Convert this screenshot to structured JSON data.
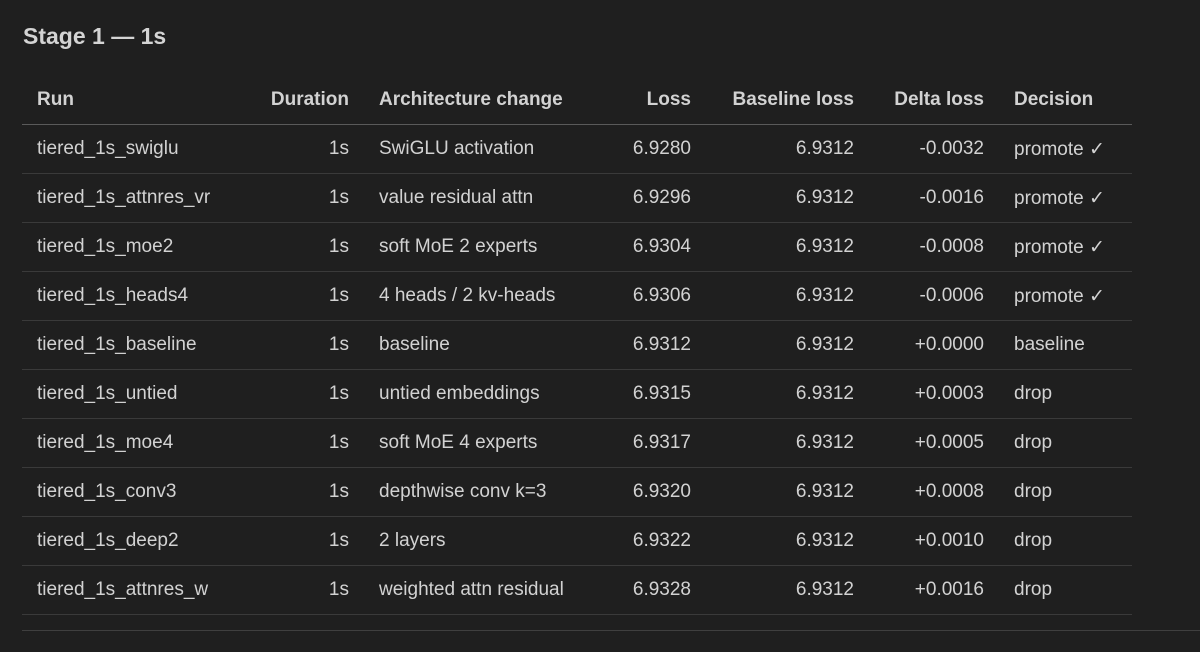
{
  "title": "Stage 1 — 1s",
  "columns": [
    "Run",
    "Duration",
    "Architecture change",
    "Loss",
    "Baseline loss",
    "Delta loss",
    "Decision"
  ],
  "rows": [
    [
      "tiered_1s_swiglu",
      "1s",
      "SwiGLU activation",
      "6.9280",
      "6.9312",
      "-0.0032",
      "promote ✓"
    ],
    [
      "tiered_1s_attnres_vr",
      "1s",
      "value residual attn",
      "6.9296",
      "6.9312",
      "-0.0016",
      "promote ✓"
    ],
    [
      "tiered_1s_moe2",
      "1s",
      "soft MoE 2 experts",
      "6.9304",
      "6.9312",
      "-0.0008",
      "promote ✓"
    ],
    [
      "tiered_1s_heads4",
      "1s",
      "4 heads / 2 kv-heads",
      "6.9306",
      "6.9312",
      "-0.0006",
      "promote ✓"
    ],
    [
      "tiered_1s_baseline",
      "1s",
      "baseline",
      "6.9312",
      "6.9312",
      "+0.0000",
      "baseline"
    ],
    [
      "tiered_1s_untied",
      "1s",
      "untied embeddings",
      "6.9315",
      "6.9312",
      "+0.0003",
      "drop"
    ],
    [
      "tiered_1s_moe4",
      "1s",
      "soft MoE 4 experts",
      "6.9317",
      "6.9312",
      "+0.0005",
      "drop"
    ],
    [
      "tiered_1s_conv3",
      "1s",
      "depthwise conv k=3",
      "6.9320",
      "6.9312",
      "+0.0008",
      "drop"
    ],
    [
      "tiered_1s_deep2",
      "1s",
      "2 layers",
      "6.9322",
      "6.9312",
      "+0.0010",
      "drop"
    ],
    [
      "tiered_1s_attnres_w",
      "1s",
      "weighted attn residual",
      "6.9328",
      "6.9312",
      "+0.0016",
      "drop"
    ]
  ]
}
